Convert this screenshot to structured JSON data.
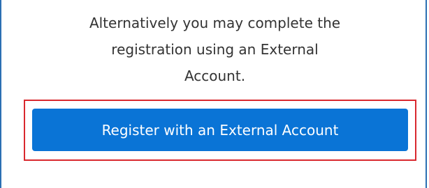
{
  "external_registration": {
    "message_lines": [
      "Alternatively you may complete the",
      "registration using an External",
      "Account."
    ],
    "button_label": "Register with an External Account"
  },
  "colors": {
    "button_background": "#0a74d6",
    "button_text": "#ffffff",
    "highlight_border": "#d9282e",
    "panel_border": "#2b6fb3",
    "body_text": "#333333"
  }
}
